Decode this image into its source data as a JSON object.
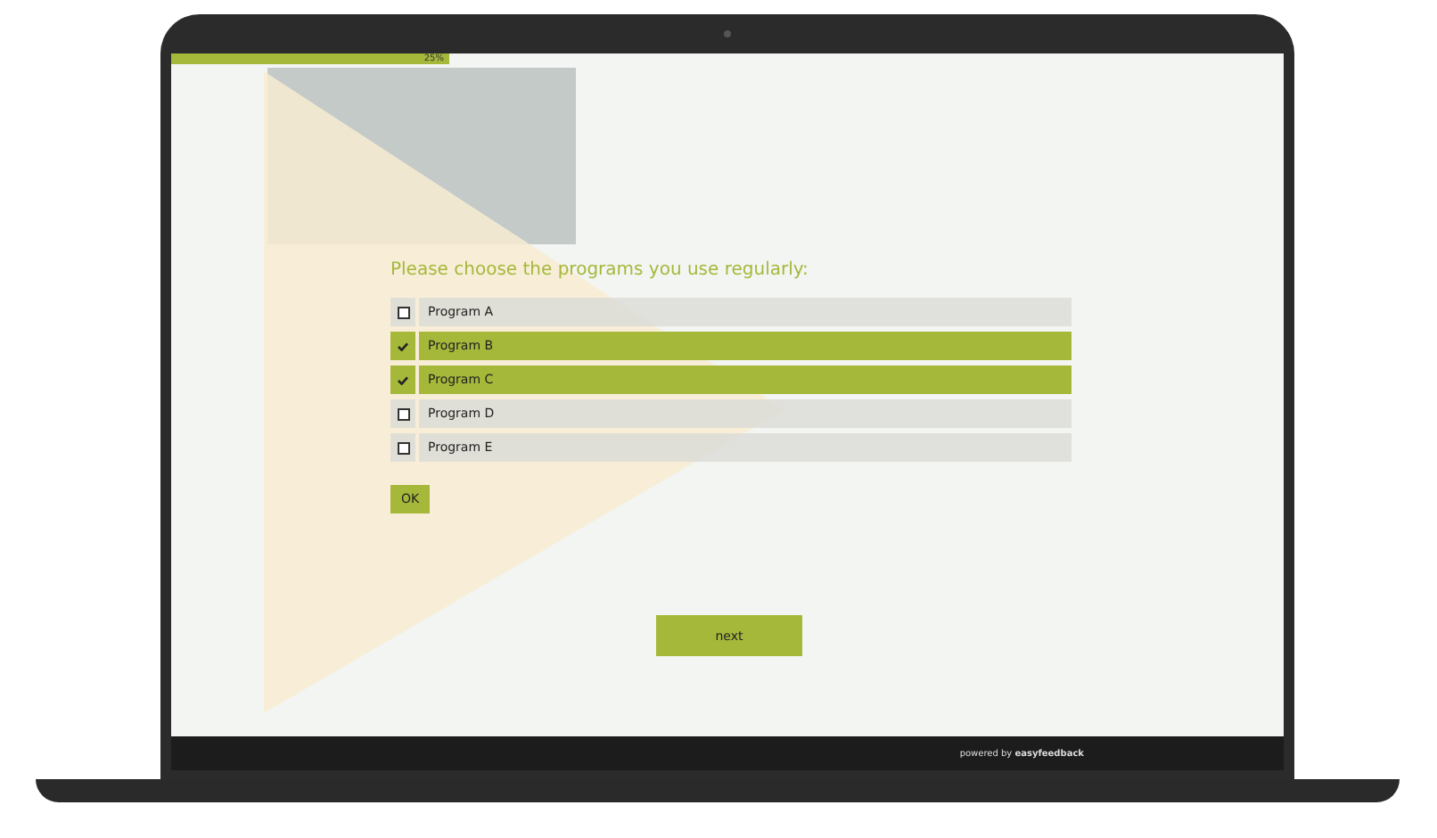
{
  "progress": {
    "level": 0.25,
    "label": "25%"
  },
  "question": "Please choose the programs you use regularly:",
  "options": [
    {
      "label": "Program A",
      "checked": false
    },
    {
      "label": "Program B",
      "checked": true
    },
    {
      "label": "Program C",
      "checked": true
    },
    {
      "label": "Program D",
      "checked": false
    },
    {
      "label": "Program E",
      "checked": false
    }
  ],
  "ok_button": "OK",
  "next_button": "next",
  "footer": "powered by **easyfeedback**"
}
